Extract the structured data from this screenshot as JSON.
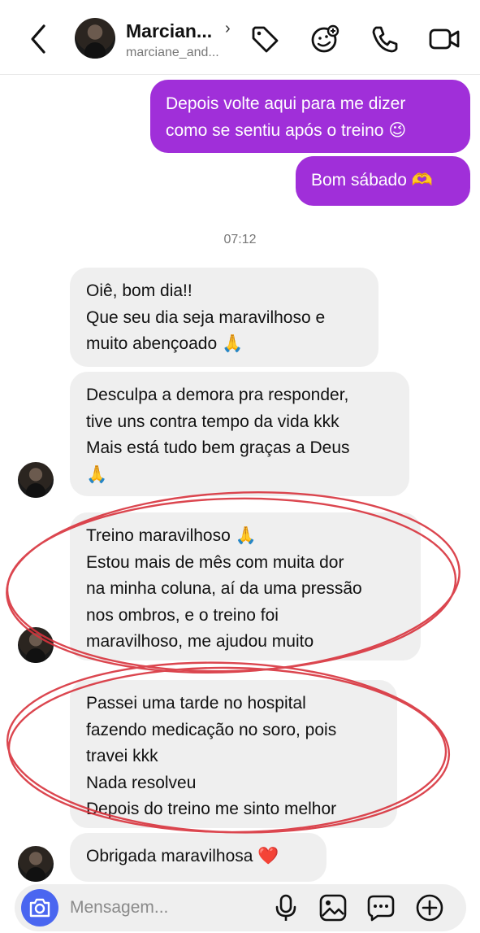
{
  "header": {
    "name": "Marcian...",
    "username": "marciane_and..."
  },
  "messages": {
    "out1": "Depois volte aqui para me dizer\ncomo se sentiu após o treino 😉",
    "out2": "Bom sábado 🫶",
    "time": "07:12",
    "in1": "Oiê, bom dia!!\nQue seu dia seja maravilhoso e\nmuito abençoado 🙏",
    "in2": "Desculpa a demora pra responder,\ntive uns contra tempo da vida kkk\nMais está tudo bem graças a Deus\n🙏",
    "in3": "Treino maravilhoso 🙏\nEstou mais de mês com muita dor\nna minha coluna, aí da uma pressão\nnos ombros, e o treino foi\nmaravilhoso, me ajudou muito",
    "in4": "Passei uma tarde no hospital\nfazendo medicação no soro, pois\ntravei kkk\nNada resolveu\nDepois do treino me sinto melhor",
    "in5": "Obrigada maravilhosa ❤️"
  },
  "composer": {
    "placeholder": "Mensagem..."
  },
  "colors": {
    "outgoing_bubble": "#a02fd9",
    "incoming_bubble": "#efefef",
    "annotation": "#d8323c",
    "camera_button": "#4a66f0"
  },
  "icons": [
    "back-arrow-icon",
    "tag-icon",
    "sticker-icon",
    "phone-icon",
    "video-icon",
    "camera-icon",
    "microphone-icon",
    "gallery-icon",
    "chat-bubble-icon",
    "plus-icon"
  ]
}
